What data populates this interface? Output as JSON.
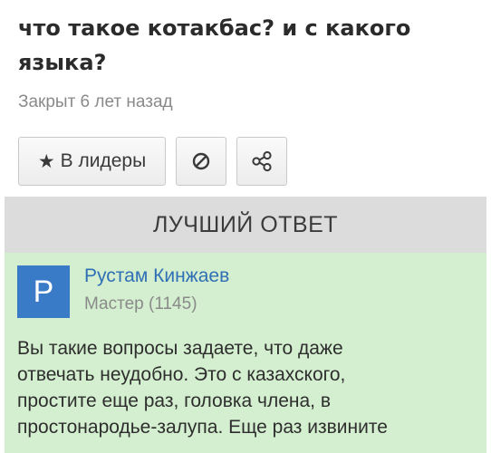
{
  "question": {
    "title_line1": "что такое котакбас? и с какого",
    "title_line2": "языка?",
    "status": "Закрыт 6 лет назад"
  },
  "actions": {
    "leaders_star": "★",
    "leaders_label": "В лидеры",
    "block_icon": "block-icon",
    "share_icon": "share-icon"
  },
  "best_answer": {
    "header": "ЛУЧШИЙ ОТВЕТ",
    "avatar_letter": "P",
    "author_name": "Рустам Кинжаев",
    "author_rank": "Мастер (1145)",
    "text_lines": [
      "Вы такие вопросы задаете, что даже",
      "отвечать неудобно. Это с казахского,",
      "простите еще раз, головка члена, в",
      "простонародье-залупа. Еще раз извините"
    ]
  },
  "colors": {
    "avatar_bg": "#3a7bc8",
    "author_link": "#2f6fb5",
    "answer_bg": "#d4efcf",
    "header_bg": "#dcdcdc"
  }
}
